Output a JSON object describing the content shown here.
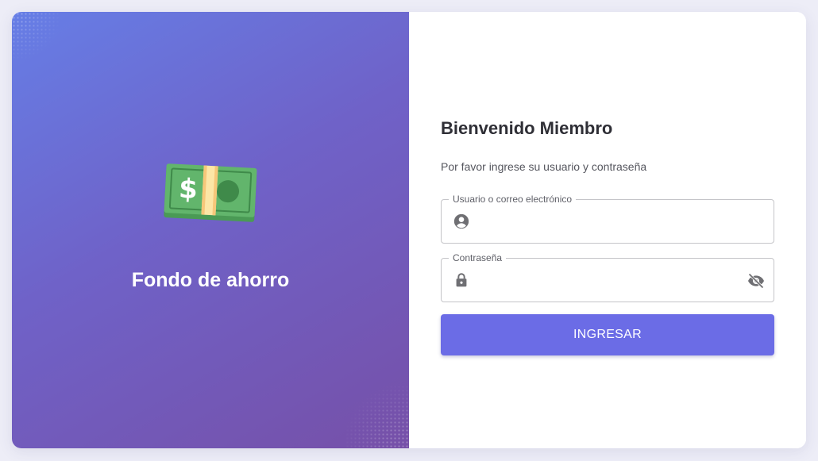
{
  "brand": {
    "title": "Fondo de ahorro",
    "icon": "money-bill-icon"
  },
  "login": {
    "heading": "Bienvenido Miembro",
    "subtitle": "Por favor ingrese su usuario y contraseña",
    "username_field": {
      "label": "Usuario o correo electrónico",
      "value": "",
      "icon": "account-circle-icon"
    },
    "password_field": {
      "label": "Contraseña",
      "value": "",
      "icon": "lock-icon",
      "toggle_icon": "eye-off-icon"
    },
    "submit_label": "INGRESAR"
  },
  "colors": {
    "gradient_start": "#667ee6",
    "gradient_end": "#7650a8",
    "button": "#6b6ce6",
    "background": "#ededf7"
  }
}
